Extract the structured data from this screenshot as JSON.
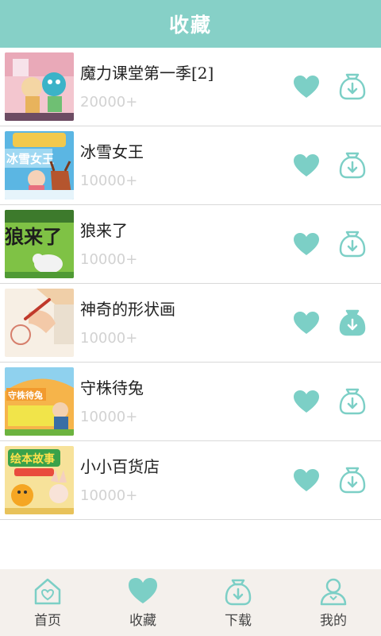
{
  "header": {
    "title": "收藏"
  },
  "items": [
    {
      "title": "魔力课堂第一季[2]",
      "count": "20000+",
      "downloaded": false
    },
    {
      "title": "冰雪女王",
      "count": "10000+",
      "downloaded": false
    },
    {
      "title": "狼来了",
      "count": "10000+",
      "downloaded": false
    },
    {
      "title": "神奇的形状画",
      "count": "10000+",
      "downloaded": true
    },
    {
      "title": "守株待兔",
      "count": "10000+",
      "downloaded": false
    },
    {
      "title": "小小百货店",
      "count": "10000+",
      "downloaded": false
    }
  ],
  "thumb_texts": {
    "t1": "冰雪女王",
    "t2": "狼来了",
    "t4": "守株待兔",
    "t5": "绘本故事"
  },
  "tabs": [
    {
      "label": "首页",
      "icon": "home-icon",
      "active": false
    },
    {
      "label": "收藏",
      "icon": "heart-icon",
      "active": true
    },
    {
      "label": "下载",
      "icon": "download-bag-icon",
      "active": false
    },
    {
      "label": "我的",
      "icon": "user-icon",
      "active": false
    }
  ],
  "colors": {
    "accent": "#86d0c7",
    "icon": "#7ccfc6",
    "tabbar_bg": "#f4f0ec",
    "count_text": "#d2d2d2"
  }
}
